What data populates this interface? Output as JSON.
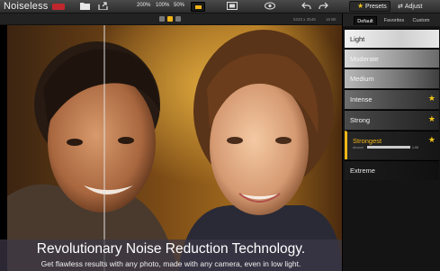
{
  "app": {
    "title": "Noiseless"
  },
  "toolbar": {
    "zoom_levels": [
      "200%",
      "100%",
      "50%"
    ],
    "presets_tab": "Presets",
    "adjust_tab": "Adjust"
  },
  "subbar": {
    "image_size": "5233 x 3548",
    "bit_depth": "16 Bit"
  },
  "panel": {
    "tabs": [
      "Default",
      "Favorites",
      "Custom"
    ],
    "presets": [
      {
        "label": "Light",
        "starred": false,
        "selected": false
      },
      {
        "label": "Moderate",
        "starred": false,
        "selected": false
      },
      {
        "label": "Medium",
        "starred": false,
        "selected": false
      },
      {
        "label": "Intense",
        "starred": true,
        "selected": false
      },
      {
        "label": "Strong",
        "starred": true,
        "selected": false
      },
      {
        "label": "Strongest",
        "starred": true,
        "selected": true,
        "amount_label": "Amount",
        "amount_value": "1.00",
        "amount_fraction": 1.0
      },
      {
        "label": "Extreme",
        "starred": false,
        "selected": false
      }
    ]
  },
  "caption": {
    "headline": "Revolutionary Noise Reduction Technology.",
    "subline": "Get flawless results with any photo, made with any camera, even in low light."
  },
  "colors": {
    "accent": "#f0b418",
    "star": "#f3c419",
    "brand_red": "#c0272d"
  }
}
